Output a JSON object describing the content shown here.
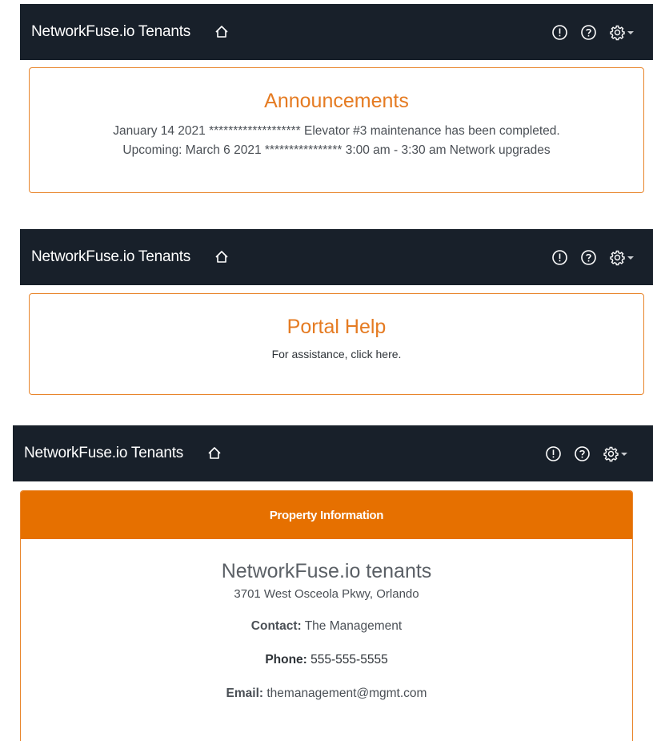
{
  "navbar": {
    "brand": "NetworkFuse.io Tenants",
    "icons": [
      "home-icon",
      "alert-icon",
      "help-icon",
      "settings-icon"
    ]
  },
  "announcements": {
    "title": "Announcements",
    "lines": [
      "January 14 2021 ******************* Elevator #3 maintenance has been completed.",
      "Upcoming: March 6 2021 **************** 3:00 am - 3:30 am Network upgrades"
    ]
  },
  "portal_help": {
    "title": "Portal Help",
    "text": "For assistance, click here."
  },
  "property": {
    "header": "Property Information",
    "name": "NetworkFuse.io tenants",
    "address": "3701 West Osceola Pkwy, Orlando",
    "contact_label": "Contact:",
    "contact_value": "The Management",
    "phone_label": "Phone:",
    "phone_value": "555-555-5555",
    "email_label": "Email:",
    "email_value": "themanagement@mgmt.com"
  },
  "colors": {
    "navbar_bg": "#18202a",
    "accent": "#e67000",
    "title_orange": "#e57b22"
  }
}
